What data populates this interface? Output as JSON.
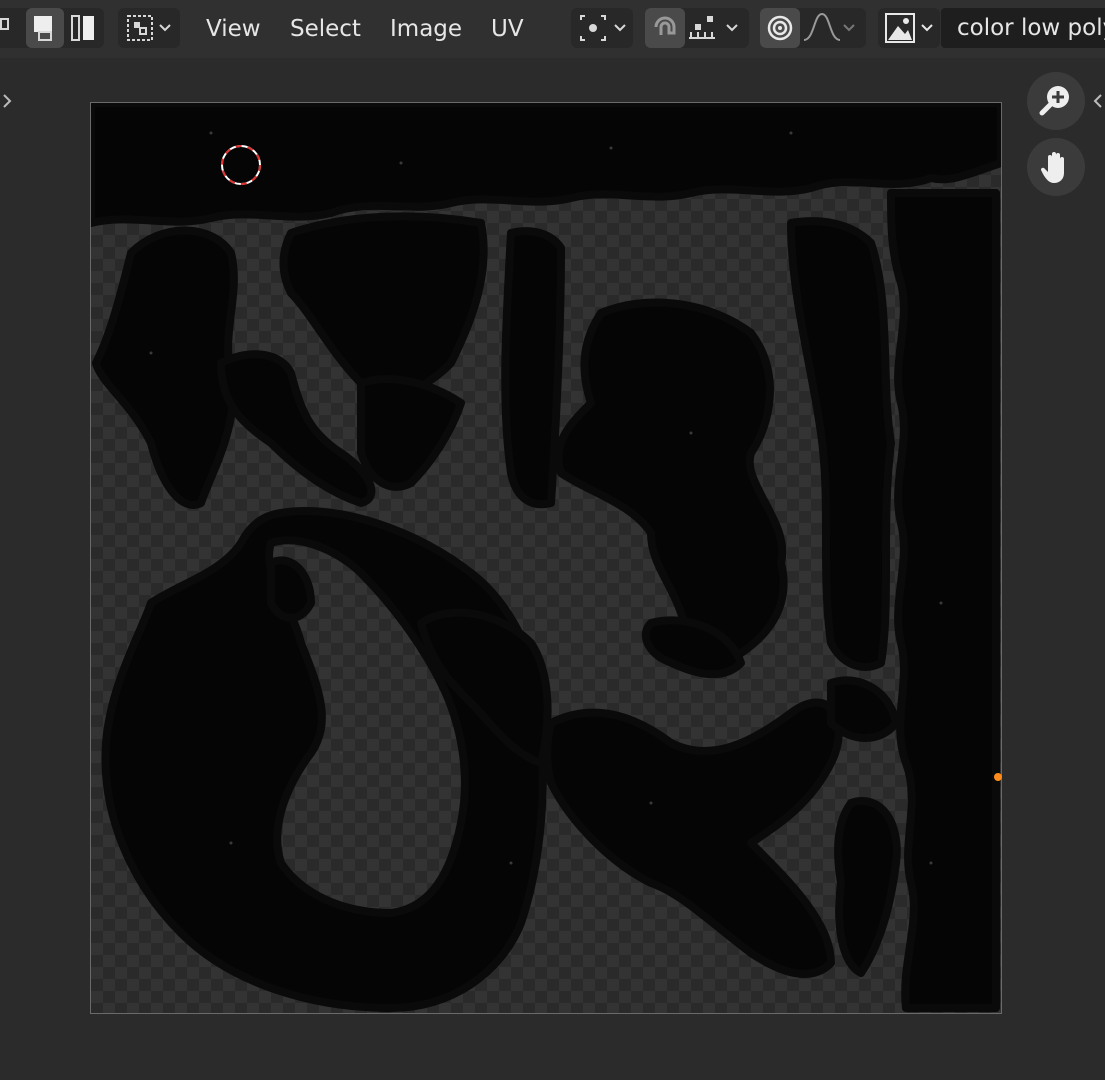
{
  "header": {
    "menu": {
      "view": "View",
      "select": "Select",
      "image": "Image",
      "uv": "UV"
    },
    "image_name": "color low poly",
    "icons": {
      "select_mode": "box-select-icon",
      "pivot": "pivot-point-icon",
      "snap": "snap-magnet-icon",
      "snap_increment": "snap-increment-icon",
      "proportional": "proportional-editing-icon",
      "falloff": "falloff-curve-icon",
      "image_browse": "image-browse-icon"
    },
    "colors": {
      "header_bg": "#303030",
      "viewport_bg": "#2b2b2b",
      "active_button": "#4a4a4a",
      "cursor_red": "#e03030",
      "orange_marker": "#ff8c1a"
    }
  },
  "viewport": {
    "gizmos": [
      "zoom-in-icon",
      "pan-hand-icon"
    ]
  }
}
